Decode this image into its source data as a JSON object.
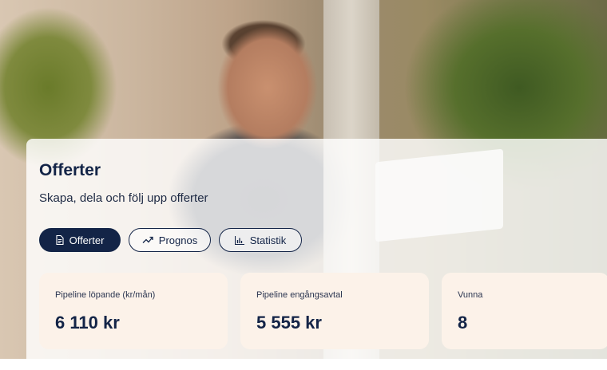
{
  "header": {
    "title": "Offerter",
    "subtitle": "Skapa, dela och följ upp offerter"
  },
  "tabs": [
    {
      "label": "Offerter",
      "icon": "document-icon",
      "active": true
    },
    {
      "label": "Prognos",
      "icon": "trend-up-icon",
      "active": false
    },
    {
      "label": "Statistik",
      "icon": "bar-chart-icon",
      "active": false
    }
  ],
  "stats": [
    {
      "label": "Pipeline löpande (kr/mån)",
      "value": "6 110 kr"
    },
    {
      "label": "Pipeline engångsavtal",
      "value": "5 555 kr"
    },
    {
      "label": "Vunna",
      "value": "8"
    }
  ],
  "colors": {
    "primary": "#132447",
    "card_bg": "#fcf2e9"
  }
}
